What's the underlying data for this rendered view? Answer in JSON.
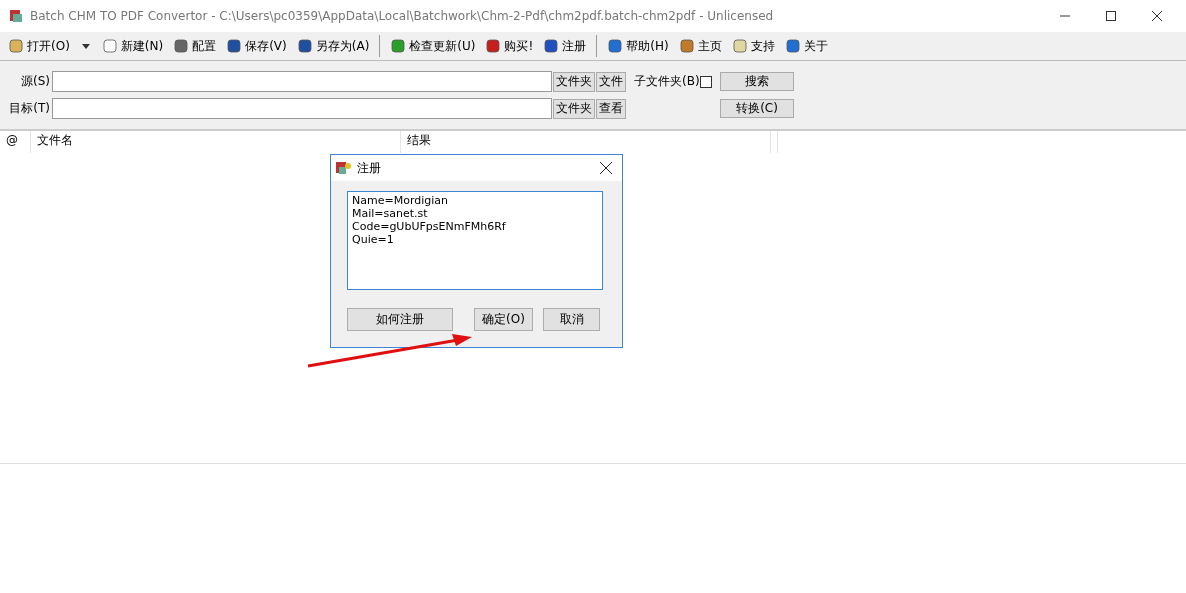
{
  "window": {
    "title": "Batch CHM TO PDF Convertor - C:\\Users\\pc0359\\AppData\\Local\\Batchwork\\Chm-2-Pdf\\chm2pdf.batch-chm2pdf - Unlicensed"
  },
  "toolbar": [
    {
      "kind": "button",
      "label": "打开(O)"
    },
    {
      "kind": "dropdown"
    },
    {
      "kind": "button",
      "label": "新建(N)"
    },
    {
      "kind": "button",
      "label": "配置"
    },
    {
      "kind": "button",
      "label": "保存(V)"
    },
    {
      "kind": "button",
      "label": "另存为(A)"
    },
    {
      "kind": "separator"
    },
    {
      "kind": "button",
      "label": "检查更新(U)"
    },
    {
      "kind": "button",
      "label": "购买!"
    },
    {
      "kind": "button",
      "label": "注册"
    },
    {
      "kind": "separator"
    },
    {
      "kind": "button",
      "label": "帮助(H)"
    },
    {
      "kind": "button",
      "label": "主页"
    },
    {
      "kind": "button",
      "label": "支持"
    },
    {
      "kind": "button",
      "label": "关于"
    }
  ],
  "source": {
    "label": "源(S)",
    "buttons": [
      "文件夹",
      "文件"
    ],
    "subfolders": {
      "label": "子文件夹(B)",
      "checked": false
    },
    "action": "搜索"
  },
  "target": {
    "label": "目标(T)",
    "buttons": [
      "文件夹",
      "查看"
    ],
    "action": "转换(C)"
  },
  "table": {
    "columns": [
      "@",
      "文件名",
      "结果"
    ]
  },
  "dialog": {
    "title": "注册",
    "text": "Name=Mordigian\nMail=sanet.st\nCode=gUbUFpsENmFMh6Rf\nQuie=1",
    "buttons": [
      "如何注册",
      "确定(O)",
      "取消"
    ]
  }
}
